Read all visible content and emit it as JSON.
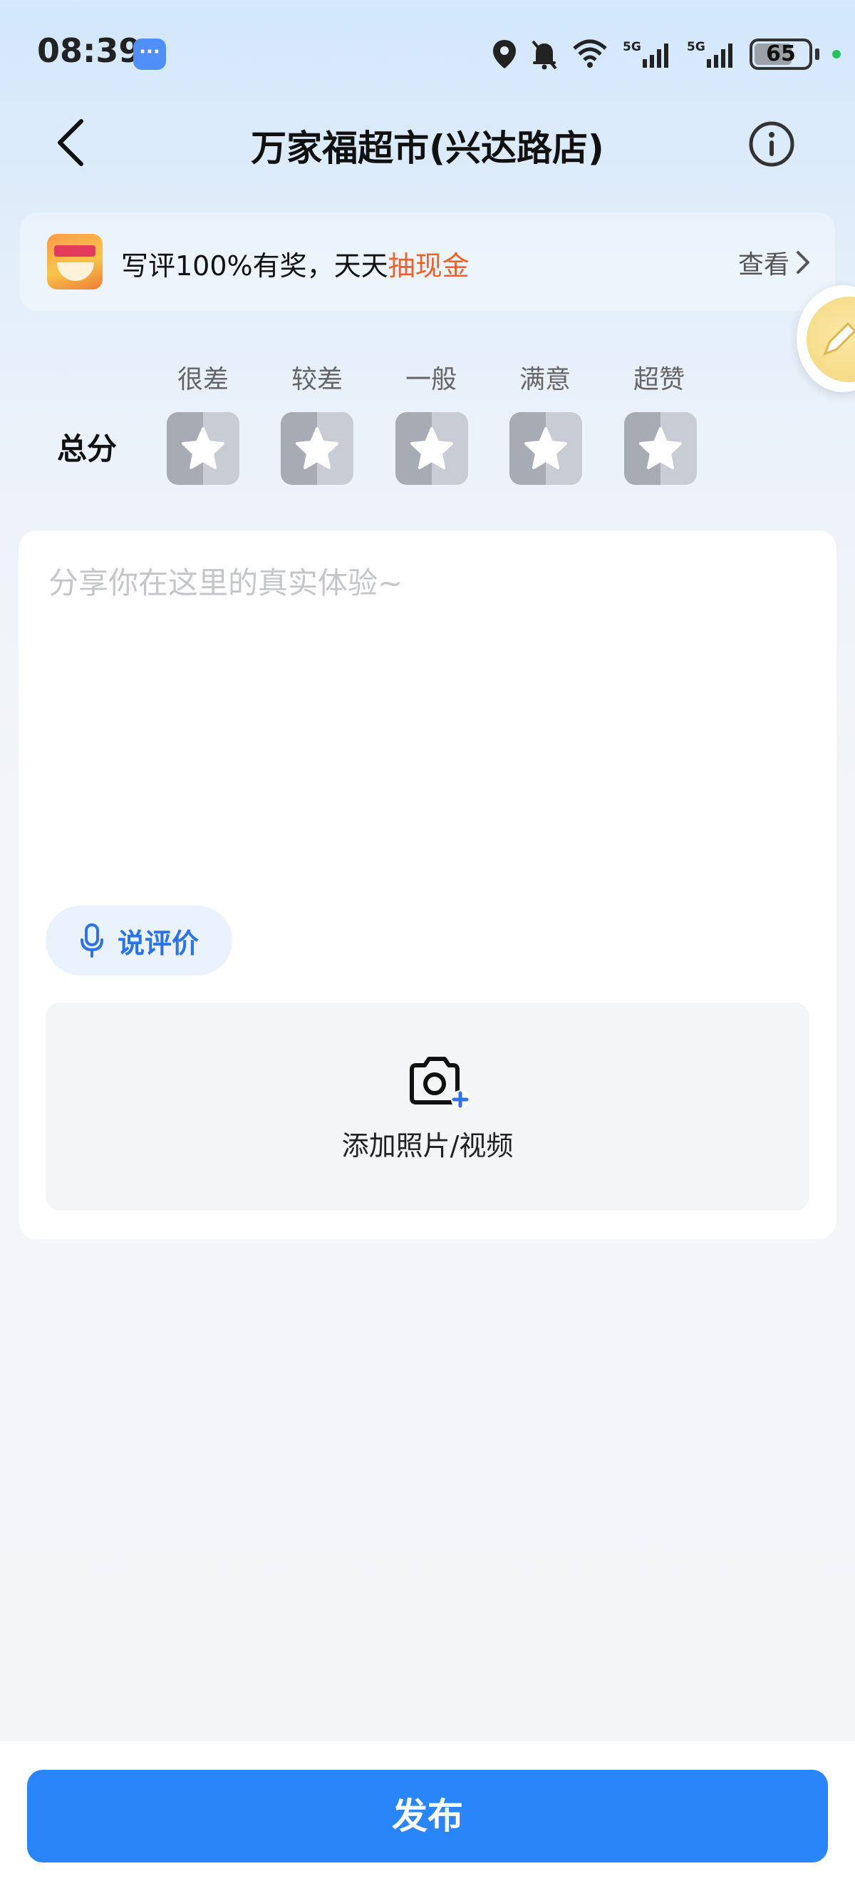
{
  "status_bar": {
    "time": "08:39",
    "battery_level": "65",
    "battery_fraction": 0.65,
    "network_labels": [
      "5G",
      "5G"
    ]
  },
  "header": {
    "title": "万家福超市(兴达路店)"
  },
  "promo": {
    "text_prefix": "写评100%有奖，天天",
    "text_highlight": "抽现金",
    "link_label": "查看"
  },
  "rating": {
    "total_label": "总分",
    "levels": [
      "很差",
      "较差",
      "一般",
      "满意",
      "超赞"
    ],
    "selected": 0
  },
  "review": {
    "placeholder": "分享你在这里的真实体验~",
    "value": "",
    "voice_label": "说评价",
    "upload_label": "添加照片/视频"
  },
  "footer": {
    "publish_label": "发布"
  },
  "colors": {
    "accent": "#2a85f8",
    "promo_highlight": "#f0602b",
    "voice_text": "#2b73e6"
  }
}
